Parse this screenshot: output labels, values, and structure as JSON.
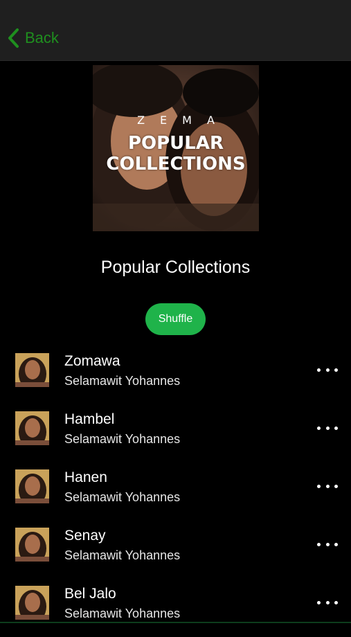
{
  "nav": {
    "back_label": "Back",
    "accent_color": "#1f8f1f"
  },
  "cover": {
    "brand": "ZEMA",
    "title_line1": "POPULAR",
    "title_line2": "COLLECTIONS"
  },
  "playlist": {
    "title": "Popular Collections",
    "shuffle_label": "Shuffle",
    "shuffle_color": "#1fb34a"
  },
  "songs": [
    {
      "title": "Zomawa",
      "artist": "Selamawit Yohannes"
    },
    {
      "title": "Hambel",
      "artist": "Selamawit Yohannes"
    },
    {
      "title": "Hanen",
      "artist": "Selamawit Yohannes"
    },
    {
      "title": "Senay",
      "artist": "Selamawit Yohannes"
    },
    {
      "title": "Bel Jalo",
      "artist": "Selamawit Yohannes"
    }
  ]
}
